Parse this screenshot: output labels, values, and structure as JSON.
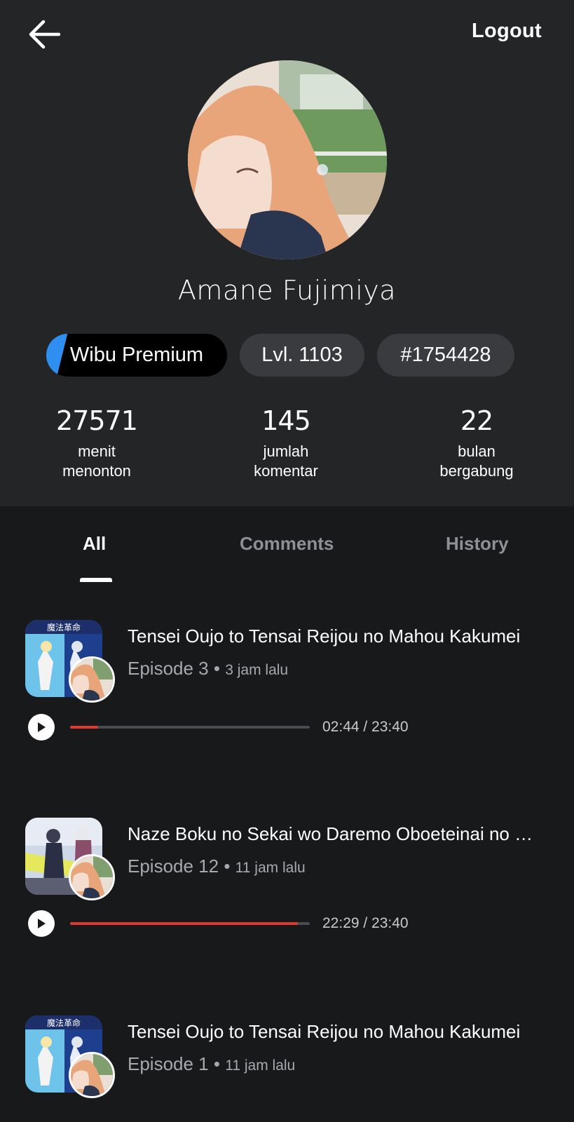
{
  "header": {
    "back_icon": "arrow-left-icon",
    "logout_label": "Logout"
  },
  "profile": {
    "name": "Amane Fujimiya",
    "badges": {
      "tier": "Wibu Premium",
      "level": "Lvl. 1103",
      "id": "#1754428"
    },
    "stats": [
      {
        "value": "27571",
        "label_line1": "menit",
        "label_line2": "menonton"
      },
      {
        "value": "145",
        "label_line1": "jumlah",
        "label_line2": "komentar"
      },
      {
        "value": "22",
        "label_line1": "bulan",
        "label_line2": "bergabung"
      }
    ]
  },
  "tabs": [
    {
      "label": "All",
      "active": true
    },
    {
      "label": "Comments",
      "active": false
    },
    {
      "label": "History",
      "active": false
    }
  ],
  "history": [
    {
      "title": "Tensei Oujo to Tensai Reijou no Mahou Kakumei",
      "episode": "Episode 3",
      "ago": "3 jam lalu",
      "time": "02:44 / 23:40",
      "progress": 0.117
    },
    {
      "title": "Naze Boku no Sekai wo Daremo Oboeteinai no Ka?",
      "episode": "Episode 12",
      "ago": "11 jam lalu",
      "time": "22:29 / 23:40",
      "progress": 0.95
    },
    {
      "title": "Tensei Oujo to Tensai Reijou no Mahou Kakumei",
      "episode": "Episode 1",
      "ago": "11 jam lalu"
    }
  ],
  "colors": {
    "accent_blue": "#2f8ff0",
    "progress_red": "#e0392f",
    "background": "#18191b",
    "header_bg": "#242527"
  }
}
